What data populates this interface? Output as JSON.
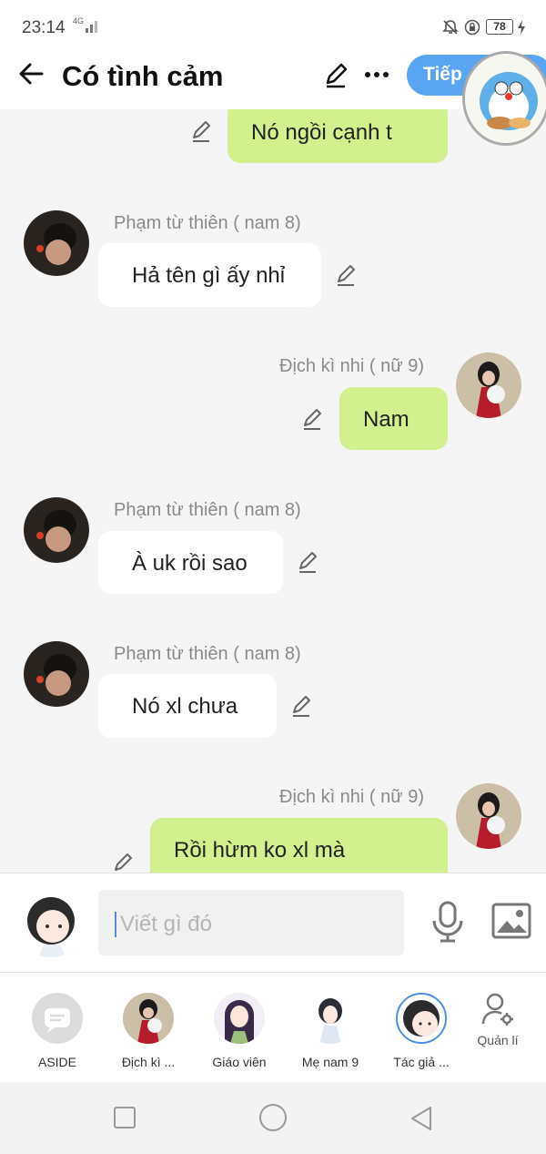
{
  "status_bar": {
    "time": "23:14",
    "network": "4G",
    "battery": "78"
  },
  "header": {
    "title": "Có tình cảm",
    "next_label": "Tiếp"
  },
  "messages": [
    {
      "text": "Nó ngồi cạnh t"
    },
    {
      "sender": "Phạm từ thiên ( nam 8)",
      "text": "Hả tên gì ấy nhỉ"
    },
    {
      "sender": "Địch kì nhi ( nữ 9)",
      "text": "Nam"
    },
    {
      "sender": "Phạm từ thiên ( nam 8)",
      "text": "À uk rồi sao"
    },
    {
      "sender": "Phạm từ thiên ( nam 8)",
      "text": "Nó xl chưa"
    },
    {
      "sender": "Địch kì nhi ( nữ 9)",
      "text": "Rồi hừm ko xl  mà"
    }
  ],
  "composer": {
    "placeholder": "Viết gì đó"
  },
  "characters": [
    {
      "label": "ASIDE"
    },
    {
      "label": "Địch kì ..."
    },
    {
      "label": "Giáo viên"
    },
    {
      "label": "Mẹ nam 9"
    },
    {
      "label": "Tác giả ..."
    },
    {
      "label": "Quản lí"
    }
  ],
  "colors": {
    "accent": "#5aa5f2",
    "right_bubble": "#d2f08e",
    "left_bubble": "#ffffff",
    "background": "#f5f5f5"
  }
}
